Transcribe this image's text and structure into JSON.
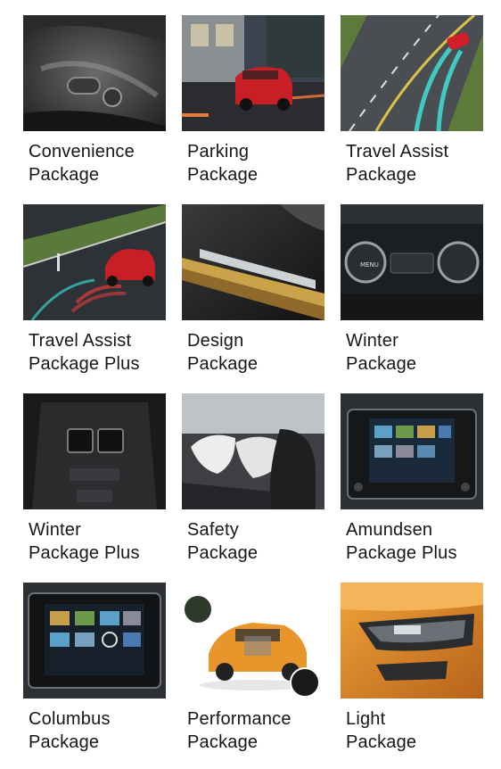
{
  "packages": [
    {
      "line1": "Convenience",
      "line2": "Package",
      "icon": "seat-controls-image"
    },
    {
      "line1": "Parking",
      "line2": "Package",
      "icon": "red-suv-parking-image"
    },
    {
      "line1": "Travel Assist",
      "line2": "Package",
      "icon": "road-lane-assist-image"
    },
    {
      "line1": "Travel Assist",
      "line2": "Package Plus",
      "icon": "parking-sensors-image"
    },
    {
      "line1": "Design",
      "line2": "Package",
      "icon": "door-sill-image"
    },
    {
      "line1": "Winter",
      "line2": "Package",
      "icon": "climate-dials-image"
    },
    {
      "line1": "Winter",
      "line2": "Package Plus",
      "icon": "rear-vents-image"
    },
    {
      "line1": "Safety",
      "line2": "Package",
      "icon": "airbags-image"
    },
    {
      "line1": "Amundsen",
      "line2": "Package Plus",
      "icon": "infotainment-screen-image"
    },
    {
      "line1": "Columbus",
      "line2": "Package",
      "icon": "navigation-screen-image"
    },
    {
      "line1": "Performance",
      "line2": "Package",
      "icon": "orange-suv-xray-image"
    },
    {
      "line1": "Light",
      "line2": "Package",
      "icon": "headlight-image"
    }
  ]
}
